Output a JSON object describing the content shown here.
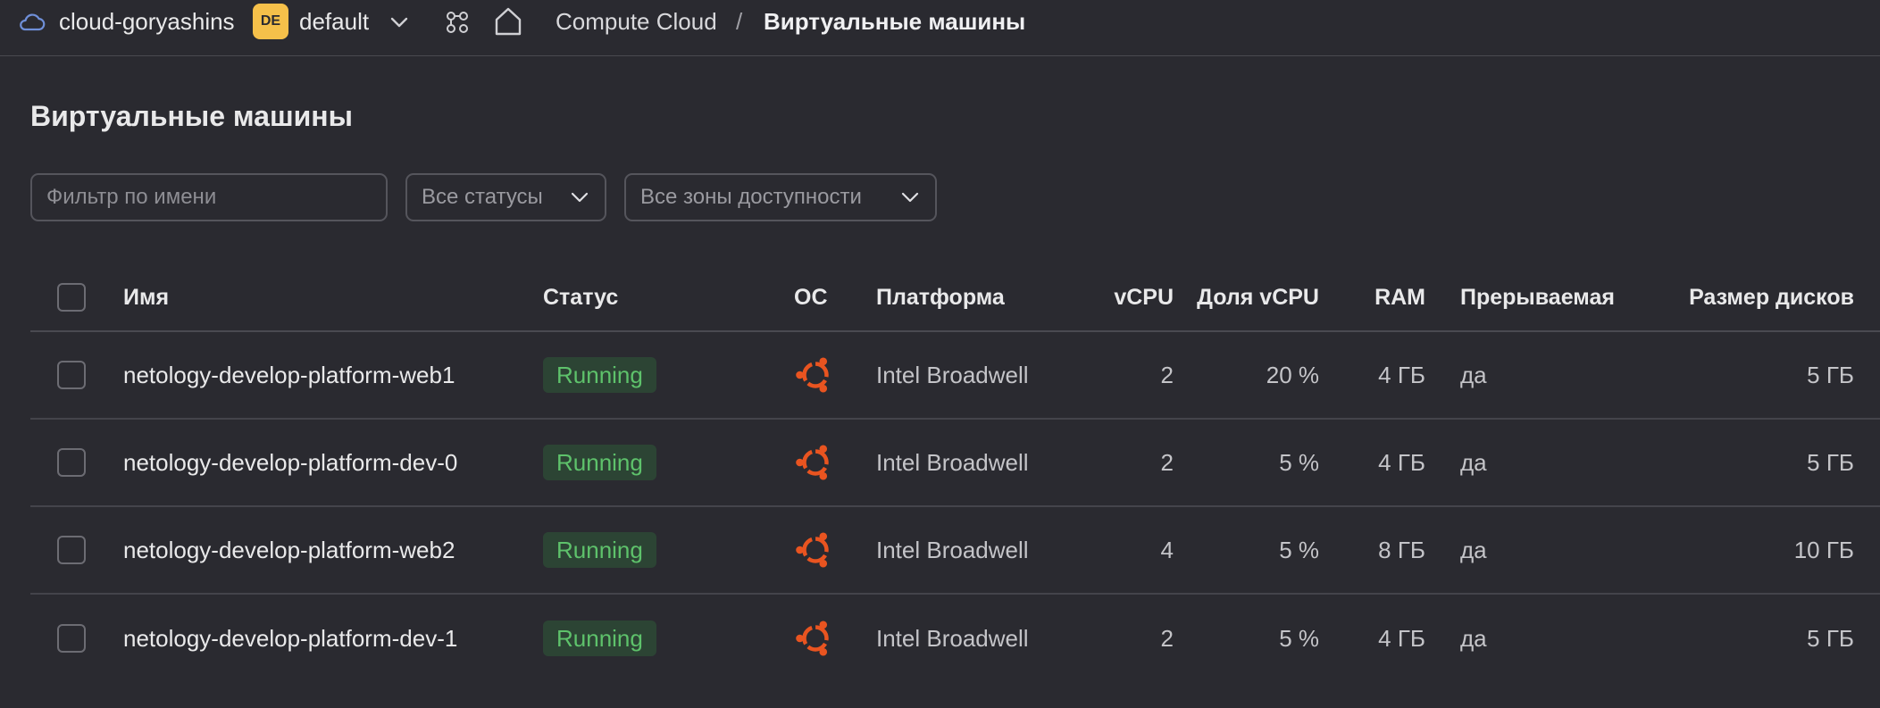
{
  "topbar": {
    "cloud_name": "cloud-goryashins",
    "folder_badge": "DE",
    "folder_name": "default",
    "breadcrumb": {
      "service": "Compute Cloud",
      "separator": "/",
      "current": "Виртуальные машины"
    }
  },
  "page": {
    "title": "Виртуальные машины"
  },
  "filters": {
    "name_placeholder": "Фильтр по имени",
    "status_value": "Все статусы",
    "zones_value": "Все зоны доступности"
  },
  "table": {
    "columns": {
      "name": "Имя",
      "status": "Статус",
      "os": "ОС",
      "platform": "Платформа",
      "vcpu": "vCPU",
      "vcpu_share": "Доля vCPU",
      "ram": "RAM",
      "preemptible": "Прерываемая",
      "disk_size": "Размер дисков"
    },
    "rows": [
      {
        "name": "netology-develop-platform-web1",
        "status": "Running",
        "os_icon": "ubuntu-icon",
        "platform": "Intel Broadwell",
        "vcpu": "2",
        "vcpu_share": "20 %",
        "ram": "4 ГБ",
        "preemptible": "да",
        "disk_size": "5 ГБ"
      },
      {
        "name": "netology-develop-platform-dev-0",
        "status": "Running",
        "os_icon": "ubuntu-icon",
        "platform": "Intel Broadwell",
        "vcpu": "2",
        "vcpu_share": "5 %",
        "ram": "4 ГБ",
        "preemptible": "да",
        "disk_size": "5 ГБ"
      },
      {
        "name": "netology-develop-platform-web2",
        "status": "Running",
        "os_icon": "ubuntu-icon",
        "platform": "Intel Broadwell",
        "vcpu": "4",
        "vcpu_share": "5 %",
        "ram": "8 ГБ",
        "preemptible": "да",
        "disk_size": "10 ГБ"
      },
      {
        "name": "netology-develop-platform-dev-1",
        "status": "Running",
        "os_icon": "ubuntu-icon",
        "platform": "Intel Broadwell",
        "vcpu": "2",
        "vcpu_share": "5 %",
        "ram": "4 ГБ",
        "preemptible": "да",
        "disk_size": "5 ГБ"
      }
    ]
  },
  "colors": {
    "background": "#2a2a30",
    "status_running_text": "#5ec26b",
    "status_running_bg": "#2c4434",
    "ubuntu_orange": "#e95420",
    "folder_badge": "#f5c04a",
    "cloud_icon": "#6f8fd8"
  }
}
